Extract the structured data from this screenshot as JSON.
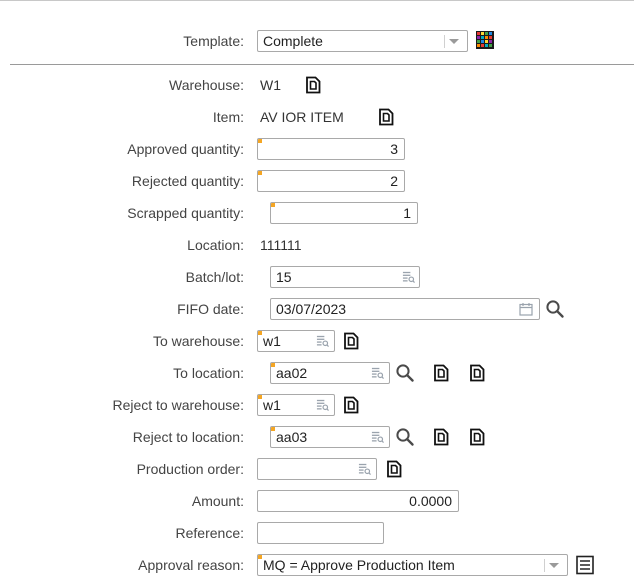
{
  "template": {
    "label": "Template:",
    "value": "Complete"
  },
  "warehouse": {
    "label": "Warehouse:",
    "value": "W1"
  },
  "item": {
    "label": "Item:",
    "value": "AV IOR ITEM"
  },
  "approved_quantity": {
    "label": "Approved quantity:",
    "value": "3"
  },
  "rejected_quantity": {
    "label": "Rejected quantity:",
    "value": "2"
  },
  "scrapped_quantity": {
    "label": "Scrapped quantity:",
    "value": "1"
  },
  "location": {
    "label": "Location:",
    "value": "111111"
  },
  "batch_lot": {
    "label": "Batch/lot:",
    "value": "15"
  },
  "fifo_date": {
    "label": "FIFO date:",
    "value": "03/07/2023"
  },
  "to_warehouse": {
    "label": "To warehouse:",
    "value": "w1"
  },
  "to_location": {
    "label": "To location:",
    "value": "aa02"
  },
  "reject_to_warehouse": {
    "label": "Reject to warehouse:",
    "value": "w1"
  },
  "reject_to_location": {
    "label": "Reject to location:",
    "value": "aa03"
  },
  "production_order": {
    "label": "Production order:",
    "value": ""
  },
  "amount": {
    "label": "Amount:",
    "value": "0.0000"
  },
  "reference": {
    "label": "Reference:",
    "value": ""
  },
  "approval_reason": {
    "label": "Approval reason:",
    "value": "MQ = Approve Production Item"
  },
  "colors": {
    "required_marker": "#f5a623",
    "border": "#a9a9a9",
    "text": "#333333"
  },
  "icons": [
    "colored-grid-icon",
    "document-icon",
    "lookup-icon",
    "calendar-icon",
    "search-icon",
    "list-icon"
  ]
}
